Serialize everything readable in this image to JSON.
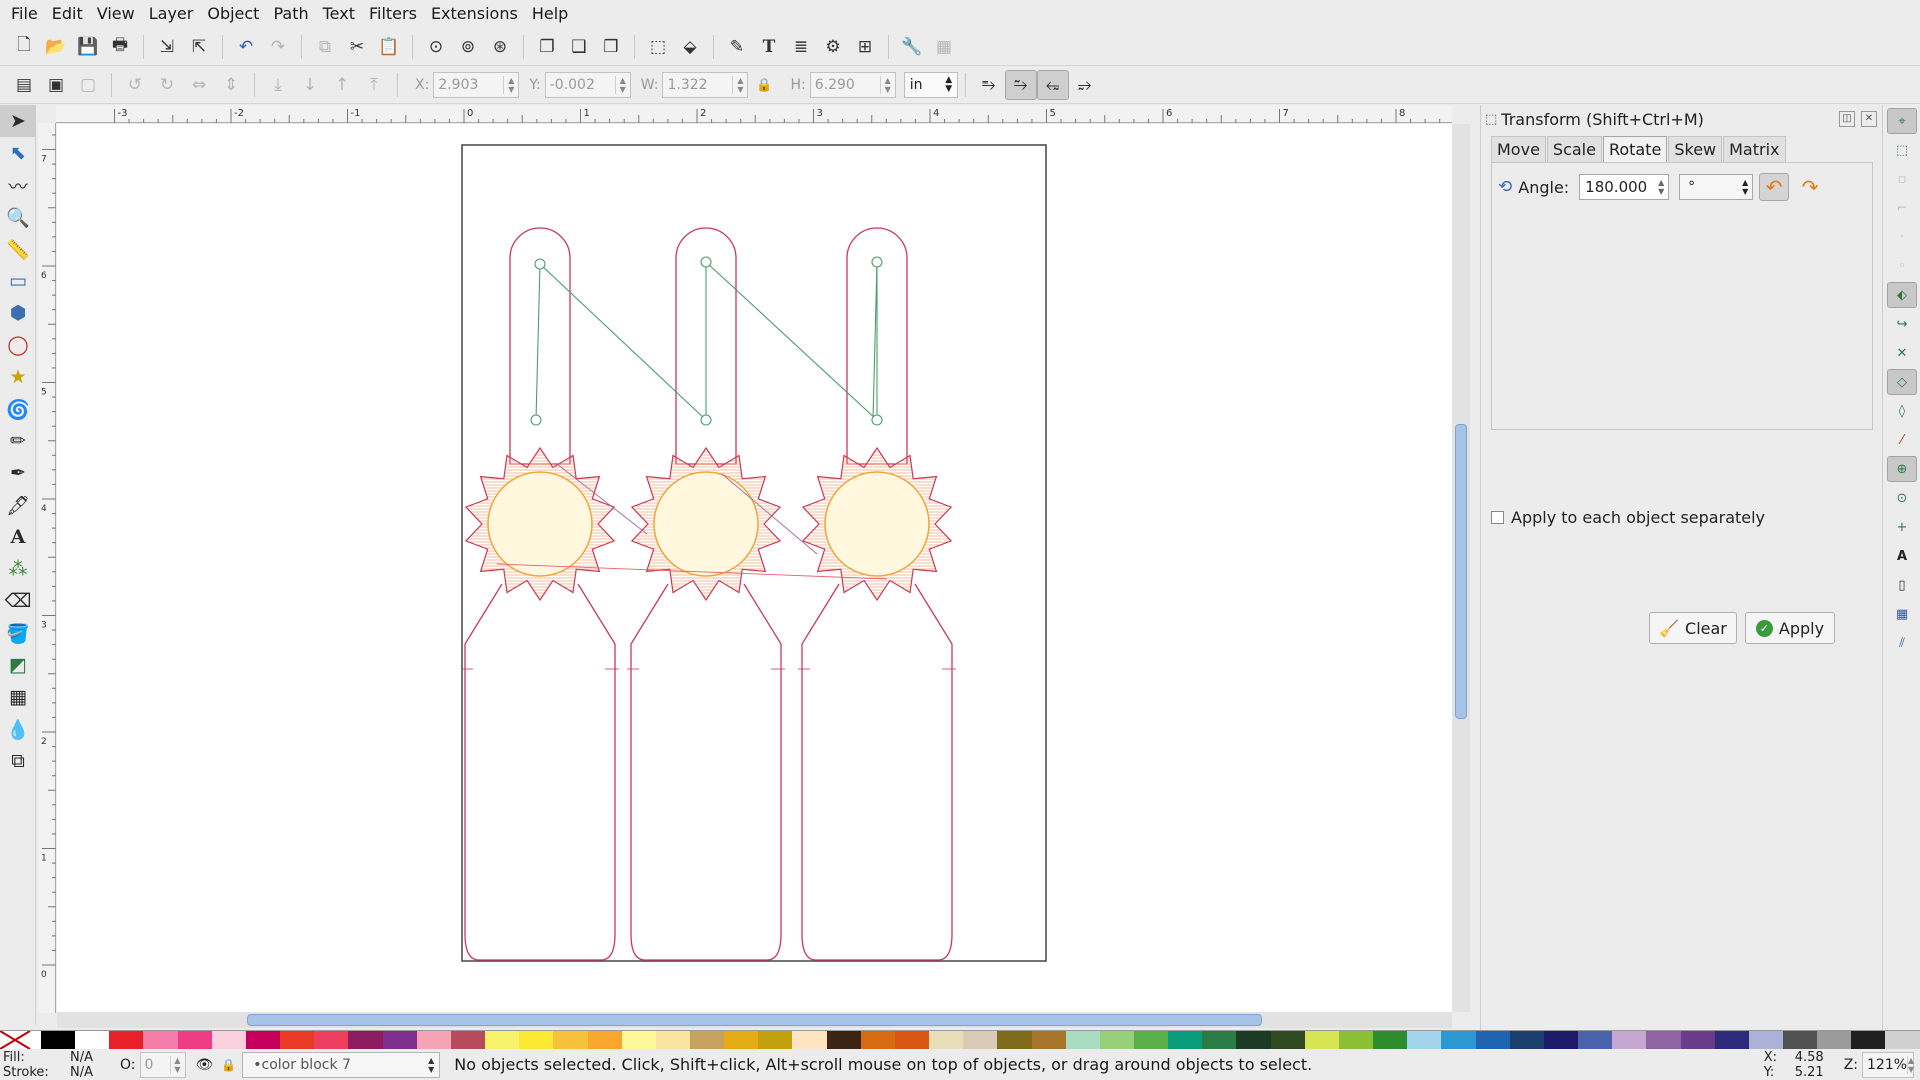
{
  "menu": [
    "File",
    "Edit",
    "View",
    "Layer",
    "Object",
    "Path",
    "Text",
    "Filters",
    "Extensions",
    "Help"
  ],
  "toolbar2": {
    "x_label": "X:",
    "x_value": "2.903",
    "y_label": "Y:",
    "y_value": "-0.002",
    "w_label": "W:",
    "w_value": "1.322",
    "h_label": "H:",
    "h_value": "6.290",
    "unit": "in"
  },
  "ruler": {
    "h_ticks": [
      "-3",
      "-2",
      "-1",
      "0",
      "1",
      "2",
      "3",
      "4",
      "5",
      "6",
      "7",
      "8"
    ],
    "v_ticks": [
      "7",
      "6",
      "5",
      "4",
      "3",
      "2",
      "1",
      "0"
    ]
  },
  "panel": {
    "title": "Transform (Shift+Ctrl+M)",
    "tabs": [
      "Move",
      "Scale",
      "Rotate",
      "Skew",
      "Matrix"
    ],
    "active_tab": "Rotate",
    "angle_label": "Angle:",
    "angle_value": "180.000",
    "angle_unit": "°",
    "apply_each_label": "Apply to each object separately",
    "clear_label": "Clear",
    "apply_label": "Apply"
  },
  "status": {
    "fill_label": "Fill:",
    "fill_value": "N/A",
    "stroke_label": "Stroke:",
    "stroke_value": "N/A",
    "opacity_label": "O:",
    "opacity_value": "0",
    "layer": "•color block 7",
    "message": "No objects selected. Click, Shift+click, Alt+scroll mouse on top of objects, or drag around objects to select.",
    "x_label": "X:",
    "x_value": "4.58",
    "y_label": "Y:",
    "y_value": "5.21",
    "zoom_label": "Z:",
    "zoom_value": "121%"
  },
  "palette": [
    "#000000",
    "#ffffff",
    "#e8202a",
    "#f27ea9",
    "#ee3d84",
    "#fbd0dd",
    "#c5005b",
    "#e83a25",
    "#ef3f61",
    "#8e1c61",
    "#7d2e8f",
    "#f6a3b7",
    "#b74a5b",
    "#f8f36b",
    "#fbe934",
    "#f7c23a",
    "#f9a72c",
    "#fef899",
    "#fbe4a2",
    "#c8a35f",
    "#e3ac15",
    "#c2a10d",
    "#fde3c0",
    "#3b2414",
    "#d76b11",
    "#d95712",
    "#e8deba",
    "#dbcab5",
    "#7e6c1c",
    "#a77529",
    "#a7dcc0",
    "#98cf7b",
    "#59b04b",
    "#0a9b7a",
    "#2a7b44",
    "#1b3b25",
    "#304a21",
    "#d6e554",
    "#8bbf36",
    "#2d8c2b",
    "#a2d5ec",
    "#2d97d3",
    "#1e63b0",
    "#1b3f6d",
    "#1c1a69",
    "#4a61ac",
    "#c6a7d0",
    "#9063a5",
    "#6b3b8b",
    "#2e2a7c",
    "#adb0d7",
    "#505152",
    "#9b9b9b",
    "#1f2120",
    "#d0d0d0"
  ]
}
